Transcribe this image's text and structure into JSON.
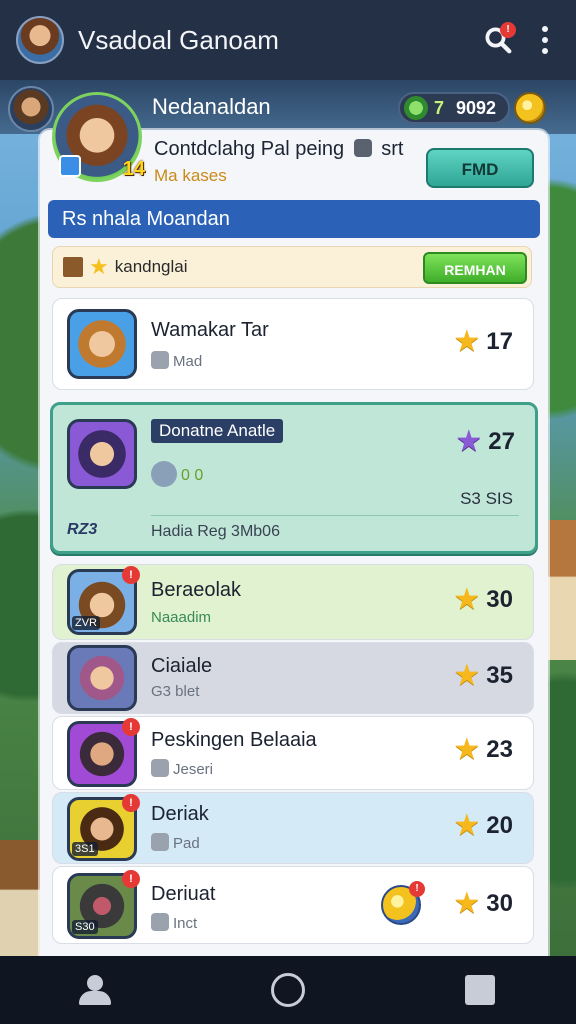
{
  "appbar": {
    "title": "Vsadoal Ganoam",
    "search_badge": "!"
  },
  "player": {
    "name": "Nedanaldan",
    "gems": "7",
    "gold": "9092",
    "level": "14"
  },
  "panel": {
    "heading": "Contdclahg Pal peing",
    "heading_suffix": "srt",
    "subheading": "Ma kases",
    "find_button": "FMD",
    "section_title": "Rs nhala Moandan",
    "quest_label": "kandnglai",
    "redeem_button": "REMHAN"
  },
  "rows": [
    {
      "name": "Wamakar Tar",
      "sub": "Mad",
      "score": "17"
    },
    {
      "name": "Donatne Anatle",
      "sub": "0 0",
      "score": "27",
      "xp": "S3 SIS",
      "team": "RZ3",
      "meta": "Hadia Reg 3Mb06"
    },
    {
      "name": "Beraeolak",
      "sub": "Naaadim",
      "score": "30",
      "tag": "ZVR"
    },
    {
      "name": "Ciaiale",
      "sub": "G3 blet",
      "score": "35"
    },
    {
      "name": "Peskingen Belaaia",
      "sub": "Jeseri",
      "score": "23"
    },
    {
      "name": "Deriak",
      "sub": "Pad",
      "score": "20",
      "tag": "3S1"
    },
    {
      "name": "Deriuat",
      "sub": "Inct",
      "score": "30",
      "tag": "S30"
    }
  ],
  "colors": {
    "appbar": "#243046",
    "accent_blue": "#2b62b8",
    "find_teal": "#2fa596",
    "redeem_green": "#3fae2a",
    "star_gold": "#f6b81c",
    "highlight_row": "#bfe6d6"
  },
  "icons": {
    "search": "search-icon",
    "menu": "more-vertical-icon",
    "star": "star-icon",
    "nav": [
      "people-icon",
      "home-circle-icon",
      "square-icon"
    ]
  }
}
